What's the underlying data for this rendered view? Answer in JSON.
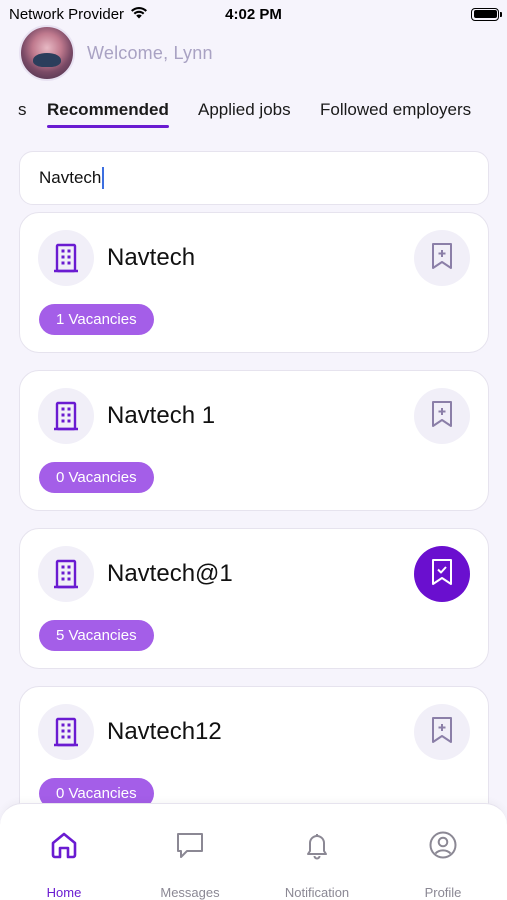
{
  "status_bar": {
    "carrier": "Network Provider",
    "time": "4:02 PM"
  },
  "header": {
    "welcome": "Welcome, Lynn"
  },
  "tabs": [
    {
      "label": "s",
      "active": false
    },
    {
      "label": "Recommended",
      "active": true
    },
    {
      "label": "Applied jobs",
      "active": false
    },
    {
      "label": "Followed employers",
      "active": false
    }
  ],
  "search": {
    "value": "Navtech"
  },
  "employers": [
    {
      "name": "Navtech",
      "vacancies": "1 Vacancies",
      "saved": false
    },
    {
      "name": "Navtech 1",
      "vacancies": "0 Vacancies",
      "saved": false
    },
    {
      "name": "Navtech@1",
      "vacancies": "5 Vacancies",
      "saved": true
    },
    {
      "name": "Navtech12",
      "vacancies": "0 Vacancies",
      "saved": false
    }
  ],
  "bottom_nav": [
    {
      "label": "Home",
      "icon": "home-icon",
      "active": true
    },
    {
      "label": "Messages",
      "icon": "message-icon",
      "active": false
    },
    {
      "label": "Notification",
      "icon": "bell-icon",
      "active": false
    },
    {
      "label": "Profile",
      "icon": "profile-icon",
      "active": false
    }
  ],
  "colors": {
    "accent": "#6a1bd1",
    "badge": "#a45ee8",
    "background": "#f6f4fc"
  }
}
